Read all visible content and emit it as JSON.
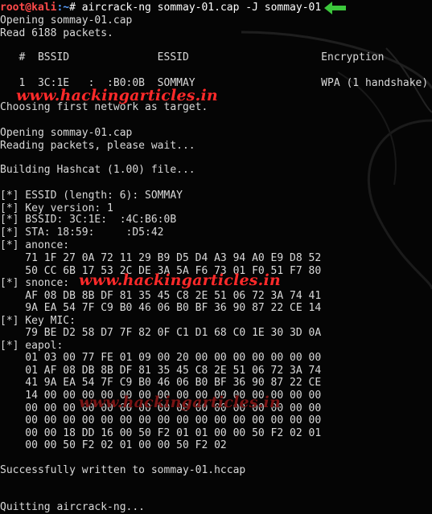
{
  "prompt": {
    "user_host": "root@kali",
    "path": ":~",
    "symbol": "# ",
    "command": "aircrack-ng sommay-01.cap -J sommay-01"
  },
  "lines": {
    "l2": "Opening sommay-01.cap",
    "l3": "Read 6188 packets.",
    "header": "   #  BSSID              ESSID                     Encryption",
    "row1": "   1  3C:1E   :  :B0:0B  SOMMAY                    WPA (1 handshake)",
    "choosing": "Choosing first network as target.",
    "opening2": "Opening sommay-01.cap",
    "reading": "Reading packets, please wait...",
    "building": "Building Hashcat (1.00) file...",
    "essid": "[*] ESSID (length: 6): SOMMAY",
    "keyver": "[*] Key version: 1",
    "bssid": "[*] BSSID: 3C:1E:  :4C:B6:0B",
    "sta": "[*] STA: 18:59:     :D5:42",
    "anonce": "[*] anonce:",
    "anonce1": "    71 1F 27 0A 72 11 29 B9 D5 D4 A3 94 A0 E9 D8 52",
    "anonce2": "    50 CC 6B 17 53 2C DE 3A 5A F6 73 01 F0 51 F7 80",
    "snonce": "[*] snonce:",
    "snonce1": "    AF 08 DB 8B DF 81 35 45 C8 2E 51 06 72 3A 74 41",
    "snonce2": "    9A EA 54 7F C9 B0 46 06 B0 BF 36 90 87 22 CE 14",
    "keymic": "[*] Key MIC:",
    "keymic1": "    79 BE D2 58 D7 7F 82 0F C1 D1 68 C0 1E 30 3D 0A",
    "eapol": "[*] eapol:",
    "eapol1": "    01 03 00 77 FE 01 09 00 20 00 00 00 00 00 00 00",
    "eapol2": "    01 AF 08 DB 8B DF 81 35 45 C8 2E 51 06 72 3A 74",
    "eapol3": "    41 9A EA 54 7F C9 B0 46 06 B0 BF 36 90 87 22 CE",
    "eapol4": "    14 00 00 00 00 00 00 00 00 00 00 00 00 00 00 00",
    "eapol5": "    00 00 00 00 00 00 00 00 00 00 00 00 00 00 00 00",
    "eapol6": "    00 00 00 00 00 00 00 00 00 00 00 00 00 00 00 00",
    "eapol7": "    00 00 18 DD 16 00 50 F2 01 01 00 00 50 F2 02 01",
    "eapol8": "    00 00 50 F2 02 01 00 00 50 F2 02",
    "success": "Successfully written to sommay-01.hccap",
    "quitting": "Quitting aircrack-ng..."
  },
  "watermark": "www.hackingarticles.in",
  "colors": {
    "text": "#d9d9d9",
    "prompt_user": "#ff4a4a",
    "prompt_path": "#5aa0ff",
    "watermark": "#ff2a2a",
    "arrow": "#3cc83c"
  },
  "icons": {
    "arrow": "green-left-arrow-icon"
  }
}
